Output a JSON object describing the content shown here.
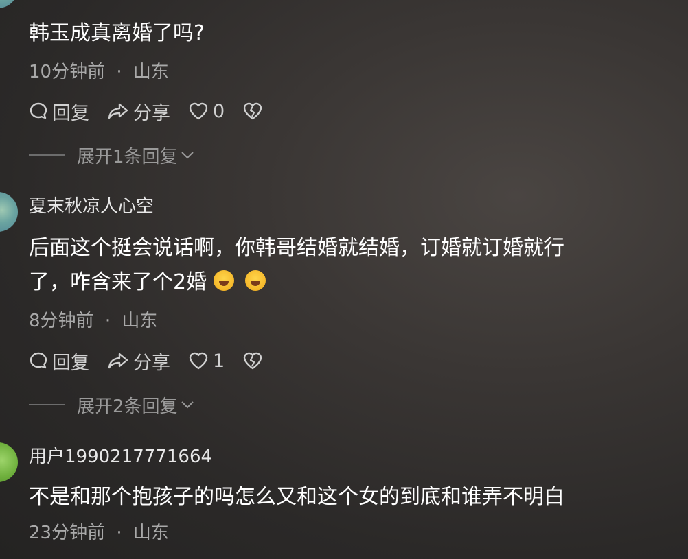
{
  "comments": [
    {
      "username": "",
      "text": "韩玉成真离婚了吗?",
      "time": "10分钟前",
      "location": "山东",
      "reply_label": "回复",
      "share_label": "分享",
      "like_count": "0",
      "expand_label": "展开1条回复"
    },
    {
      "username": "夏末秋凉人心空",
      "text_line1": "后面这个挺会说话啊，你韩哥结婚就结婚，订婚就订婚就行",
      "text_line2": "了，咋含来了个2婚",
      "emojis": [
        "laughing-crying-emoji",
        "laughing-crying-emoji"
      ],
      "time": "8分钟前",
      "location": "山东",
      "reply_label": "回复",
      "share_label": "分享",
      "like_count": "1",
      "expand_label": "展开2条回复"
    },
    {
      "username": "用户1990217771664",
      "text": "不是和那个抱孩子的吗怎么又和这个女的到底和谁弄不明白",
      "time": "23分钟前",
      "location": "山东"
    }
  ],
  "meta_separator": "·"
}
